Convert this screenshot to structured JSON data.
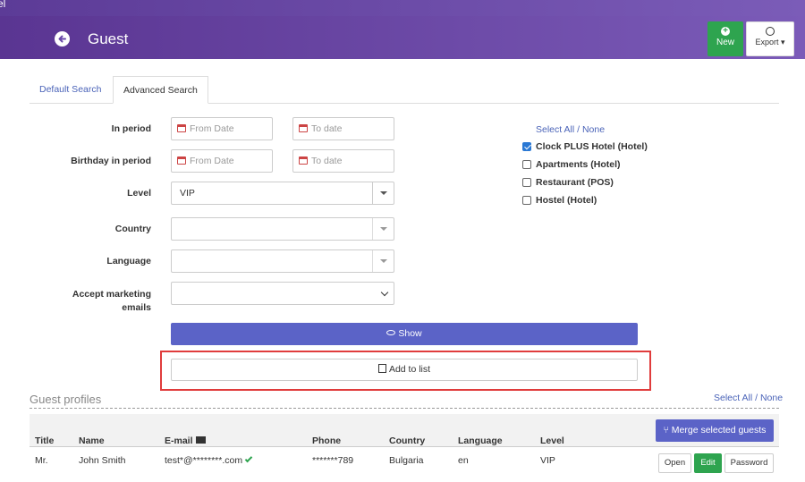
{
  "topbar": {
    "fragment": "el"
  },
  "header": {
    "title": "Guest",
    "new_label": "New",
    "export_label": "Export",
    "icons": [
      "back-arrow-icon",
      "plus-circle-icon",
      "download-icon"
    ]
  },
  "tabs": [
    {
      "label": "Default Search",
      "active": false
    },
    {
      "label": "Advanced Search",
      "active": true
    }
  ],
  "form": {
    "in_period_label": "In period",
    "birthday_label": "Birthday in period",
    "level_label": "Level",
    "country_label": "Country",
    "language_label": "Language",
    "marketing_label_1": "Accept marketing",
    "marketing_label_2": "emails",
    "from_placeholder": "From Date",
    "to_placeholder": "To date",
    "level_value": "VIP",
    "country_value": "",
    "language_value": "",
    "marketing_value": ""
  },
  "properties": {
    "select_all": "Select All",
    "separator": "/",
    "none": "None",
    "items": [
      {
        "label": "Clock PLUS Hotel (Hotel)",
        "checked": true
      },
      {
        "label": "Apartments (Hotel)",
        "checked": false
      },
      {
        "label": "Restaurant (POS)",
        "checked": false
      },
      {
        "label": "Hostel (Hotel)",
        "checked": false
      }
    ]
  },
  "actions": {
    "show_label": "Show",
    "add_to_list_label": "Add to list"
  },
  "profiles": {
    "title": "Guest profiles",
    "select_all": "Select All",
    "separator": "/",
    "none": "None",
    "merge_label": "Merge selected guests",
    "columns": [
      "Title",
      "Name",
      "E-mail",
      "Phone",
      "Country",
      "Language",
      "Level"
    ],
    "rows": [
      {
        "title": "Mr.",
        "name": "John Smith",
        "email": "test*@********.com",
        "phone": "*******789",
        "country": "Bulgaria",
        "language": "en",
        "level": "VIP"
      }
    ],
    "row_actions": {
      "open": "Open",
      "edit": "Edit",
      "password": "Password"
    }
  },
  "colors": {
    "header": "#6a48a8",
    "primary": "#5b63c7",
    "success": "#2ea44f",
    "highlight": "#e03c3c",
    "link": "#4a63b8"
  }
}
